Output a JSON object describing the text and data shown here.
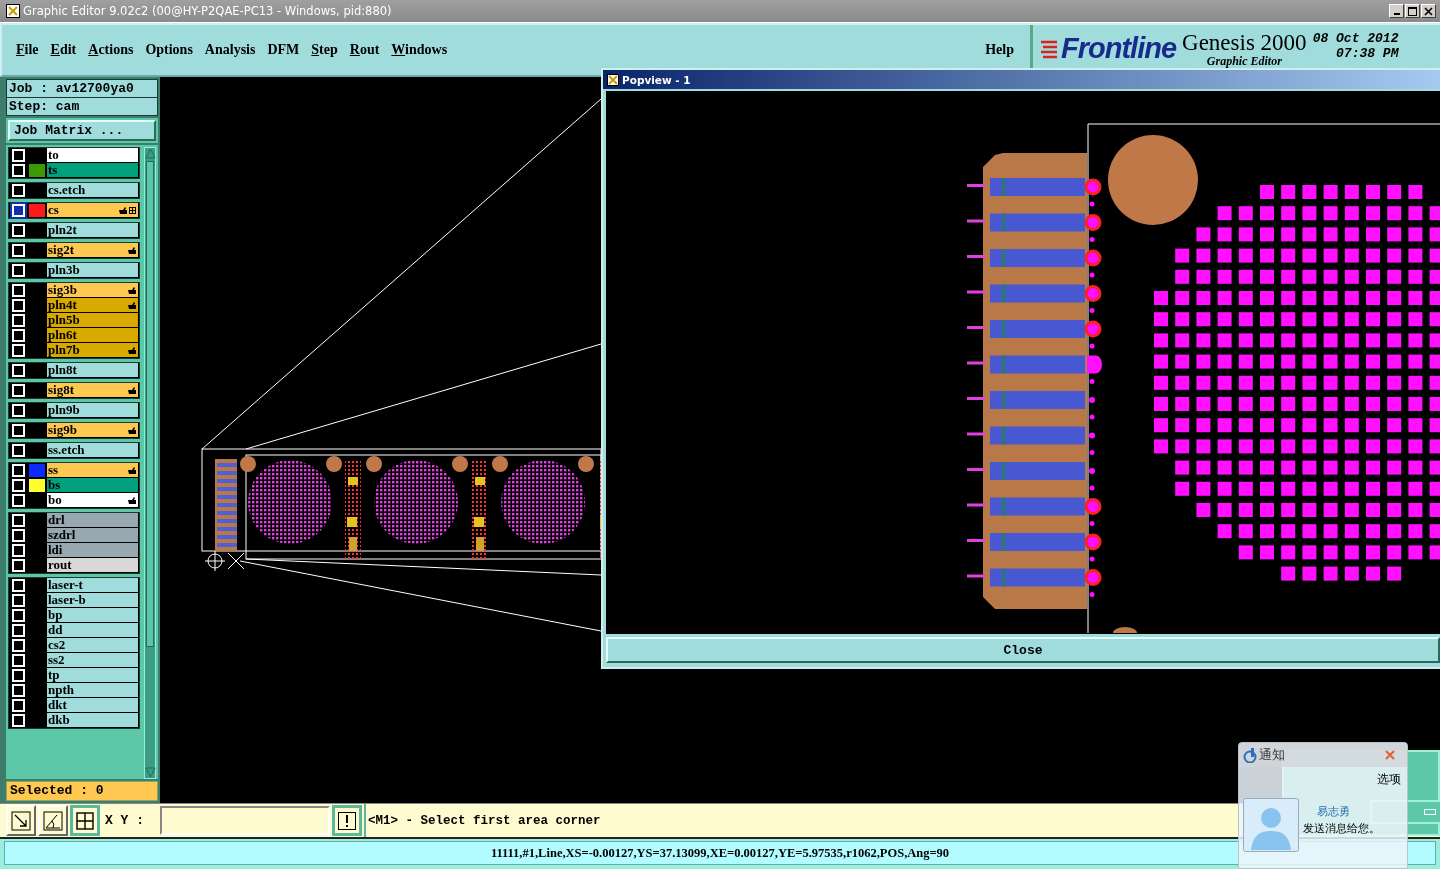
{
  "window": {
    "title": "Graphic Editor 9.02c2 (00@HY-P2QAE-PC13 - Windows, pid:880)"
  },
  "menu": [
    {
      "label": "File",
      "mnemonic": true
    },
    {
      "label": "Edit",
      "mnemonic": true
    },
    {
      "label": "Actions",
      "mnemonic": true
    },
    {
      "label": "Options",
      "mnemonic": false
    },
    {
      "label": "Analysis",
      "mnemonic": false
    },
    {
      "label": "DFM",
      "mnemonic": false
    },
    {
      "label": "Step",
      "mnemonic": true
    },
    {
      "label": "Rout",
      "mnemonic": true
    },
    {
      "label": "Windows",
      "mnemonic": true
    }
  ],
  "help_menu": "Help",
  "brand": {
    "logo": "Frontline",
    "product": "Genesis 2000",
    "subtitle": "Graphic Editor",
    "date": "08 Oct 2012",
    "time": "07:38 PM"
  },
  "job": {
    "job": "Job : av12700ya0",
    "step": "Step: cam",
    "matrix_button": "Job Matrix ..."
  },
  "layer_groups": [
    [
      {
        "name": "to",
        "color": "#ffffff",
        "work": false,
        "affected": false
      },
      {
        "name": "ts",
        "color": "#00a07c",
        "swatch": {
          "color": "#3c9a00"
        },
        "work": false,
        "affected": false
      }
    ],
    [
      {
        "name": "cs.etch",
        "color": "#a0dcdc",
        "work": false,
        "affected": false
      }
    ],
    [
      {
        "name": "cs",
        "color": "#ffc850",
        "swatch": {
          "color": "#ff1a1a"
        },
        "work": true,
        "affected": true
      }
    ],
    [
      {
        "name": "pln2t",
        "color": "#a0dcdc",
        "work": false,
        "affected": false
      }
    ],
    [
      {
        "name": "sig2t",
        "color": "#ffc850",
        "work": false,
        "affected": true
      }
    ],
    [
      {
        "name": "pln3b",
        "color": "#a0dcdc",
        "work": false,
        "affected": false
      }
    ],
    [
      {
        "name": "sig3b",
        "color": "#ffc850",
        "work": false,
        "affected": true
      },
      {
        "name": "pln4t",
        "color": "#d8aa00",
        "work": false,
        "affected": true
      },
      {
        "name": "pln5b",
        "color": "#d8aa00",
        "work": false,
        "affected": false
      },
      {
        "name": "pln6t",
        "color": "#d8aa00",
        "work": false,
        "affected": false
      },
      {
        "name": "pln7b",
        "color": "#d8aa00",
        "work": false,
        "affected": true
      }
    ],
    [
      {
        "name": "pln8t",
        "color": "#a0dcdc",
        "work": false,
        "affected": false
      }
    ],
    [
      {
        "name": "sig8t",
        "color": "#ffc850",
        "work": false,
        "affected": true
      }
    ],
    [
      {
        "name": "pln9b",
        "color": "#a0dcdc",
        "work": false,
        "affected": false
      }
    ],
    [
      {
        "name": "sig9b",
        "color": "#ffc850",
        "work": false,
        "affected": true
      }
    ],
    [
      {
        "name": "ss.etch",
        "color": "#a0dcdc",
        "work": false,
        "affected": false
      }
    ],
    [
      {
        "name": "ss",
        "color": "#ffc850",
        "swatch": {
          "color": "#0a2aff"
        },
        "work": false,
        "affected": true
      },
      {
        "name": "bs",
        "color": "#00a07c",
        "swatch": {
          "color": "#ffff30"
        },
        "work": false,
        "affected": false
      },
      {
        "name": "bo",
        "color": "#ffffff",
        "work": false,
        "affected": true
      }
    ],
    [
      {
        "name": "drl",
        "color": "#98a8b0",
        "work": false,
        "affected": false
      },
      {
        "name": "szdrl",
        "color": "#98a8b0",
        "work": false,
        "affected": false
      },
      {
        "name": "ldi",
        "color": "#98a8b0",
        "work": false,
        "affected": false
      },
      {
        "name": "rout",
        "color": "#d8d8d8",
        "work": false,
        "affected": false
      }
    ],
    [
      {
        "name": "laser-t",
        "color": "#a0dcdc",
        "work": false,
        "affected": false
      },
      {
        "name": "laser-b",
        "color": "#a0dcdc",
        "work": false,
        "affected": false
      },
      {
        "name": "bp",
        "color": "#a0dcdc",
        "work": false,
        "affected": false
      },
      {
        "name": "dd",
        "color": "#a0dcdc",
        "work": false,
        "affected": false
      },
      {
        "name": "cs2",
        "color": "#a0dcdc",
        "work": false,
        "affected": false
      },
      {
        "name": "ss2",
        "color": "#a0dcdc",
        "work": false,
        "affected": false
      },
      {
        "name": "tp",
        "color": "#a0dcdc",
        "work": false,
        "affected": false
      },
      {
        "name": "npth",
        "color": "#a0dcdc",
        "work": false,
        "affected": false
      },
      {
        "name": "dkt",
        "color": "#a0dcdc",
        "work": false,
        "affected": false
      },
      {
        "name": "dkb",
        "color": "#a0dcdc",
        "work": false,
        "affected": false
      }
    ]
  ],
  "selected_count": "Selected : 0",
  "popview": {
    "title": "Popview - 1",
    "close_button": "Close"
  },
  "toolbar": {
    "xy_label": "X Y :",
    "prompt": "<M1> - Select first area corner"
  },
  "status_bar": "11111,#1,Line,XS=-0.00127,YS=37.13099,XE=0.00127,YE=5.97535,r1062,POS,Ang=90",
  "notification": {
    "title": "通知",
    "options_link": "选项",
    "sender": "易志勇",
    "message": "发送消息给您。"
  }
}
